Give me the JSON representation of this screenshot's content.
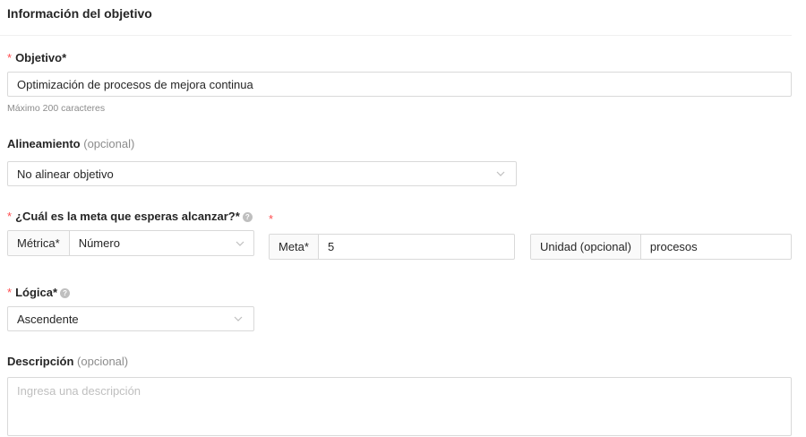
{
  "section": {
    "title": "Información del objetivo"
  },
  "objective": {
    "required_mark": "*",
    "label": "Objetivo*",
    "value": "Optimización de procesos de mejora continua",
    "hint": "Máximo 200 caracteres"
  },
  "alignment": {
    "label": "Alineamiento",
    "optional": "(opcional)",
    "value": "No alinear objetivo",
    "icon": "chevron-down-icon"
  },
  "goal": {
    "required_mark": "*",
    "label": "¿Cuál es la meta que esperas alcanzar?*",
    "help_icon": "?",
    "metric_addon": "Métrica*",
    "metric_value": "Número",
    "target_required_mark": "*",
    "target_addon": "Meta*",
    "target_value": "5",
    "unit_addon": "Unidad (opcional)",
    "unit_value": "procesos"
  },
  "logic": {
    "required_mark": "*",
    "label": "Lógica*",
    "help_icon": "?",
    "value": "Ascendente"
  },
  "description": {
    "label": "Descripción",
    "optional": "(opcional)",
    "placeholder": "Ingresa una descripción"
  },
  "colors": {
    "required": "#ff4d4f",
    "border": "#d9d9d9",
    "muted": "#8c8c8c",
    "addon_bg": "#fafafa"
  }
}
